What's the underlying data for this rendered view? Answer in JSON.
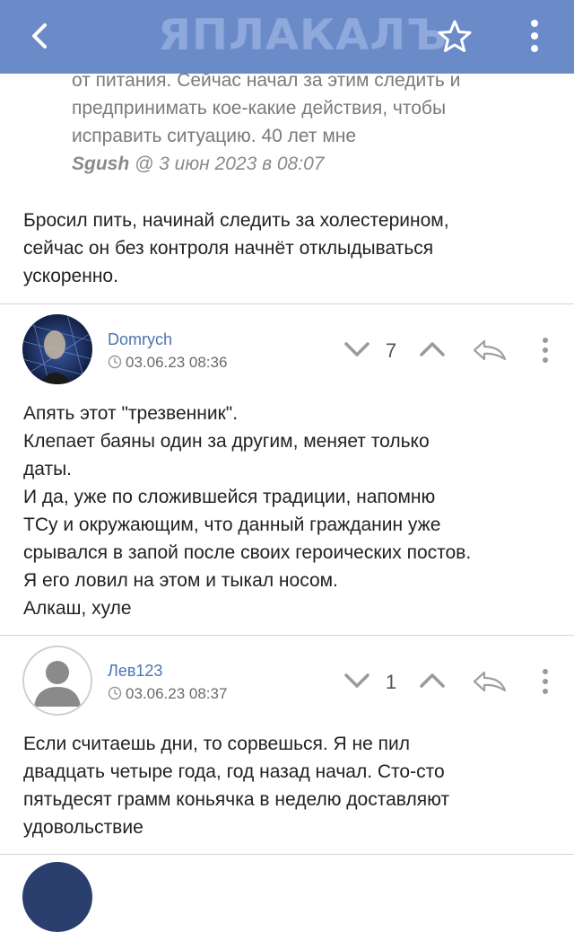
{
  "app": {
    "logo_text": "ЯПЛАКАЛЪ"
  },
  "quote": {
    "line1": "от питания. Сейчас начал за этим следить и",
    "line2": "предпринимать кое-какие действия, чтобы",
    "line3": "исправить ситуацию. 40 лет мне",
    "author": "Sgush",
    "date": " @ 3 июн 2023 в 08:07"
  },
  "reply_text": {
    "line1": "Бросил пить, начинай следить за холестерином,",
    "line2": "сейчас он без контроля начнёт отклыдываться",
    "line3": "ускоренно."
  },
  "comments": [
    {
      "author": "Domrych",
      "time": "03.06.23 08:36",
      "score": "7",
      "lines": [
        "Апять этот \"трезвенник\".",
        "Клепает баяны один за другим, меняет только",
        "даты.",
        "И да, уже по сложившейся традиции, напомню",
        "ТСу и окружающим, что данный гражданин уже",
        "срывался в запой после своих героических постов.",
        "Я его ловил на этом и тыкал носом.",
        "Алкаш, хуле"
      ]
    },
    {
      "author": "Лев123",
      "time": "03.06.23 08:37",
      "score": "1",
      "lines": [
        "Если считаешь дни, то сорвешься. Я не пил",
        "двадцать четыре года, год назад начал. Сто-сто",
        "пятьдесят грамм коньячка в неделю доставляют",
        "удовольствие"
      ]
    }
  ],
  "colors": {
    "topbar": "#6b8bc8",
    "author_link": "#4a74b0"
  }
}
